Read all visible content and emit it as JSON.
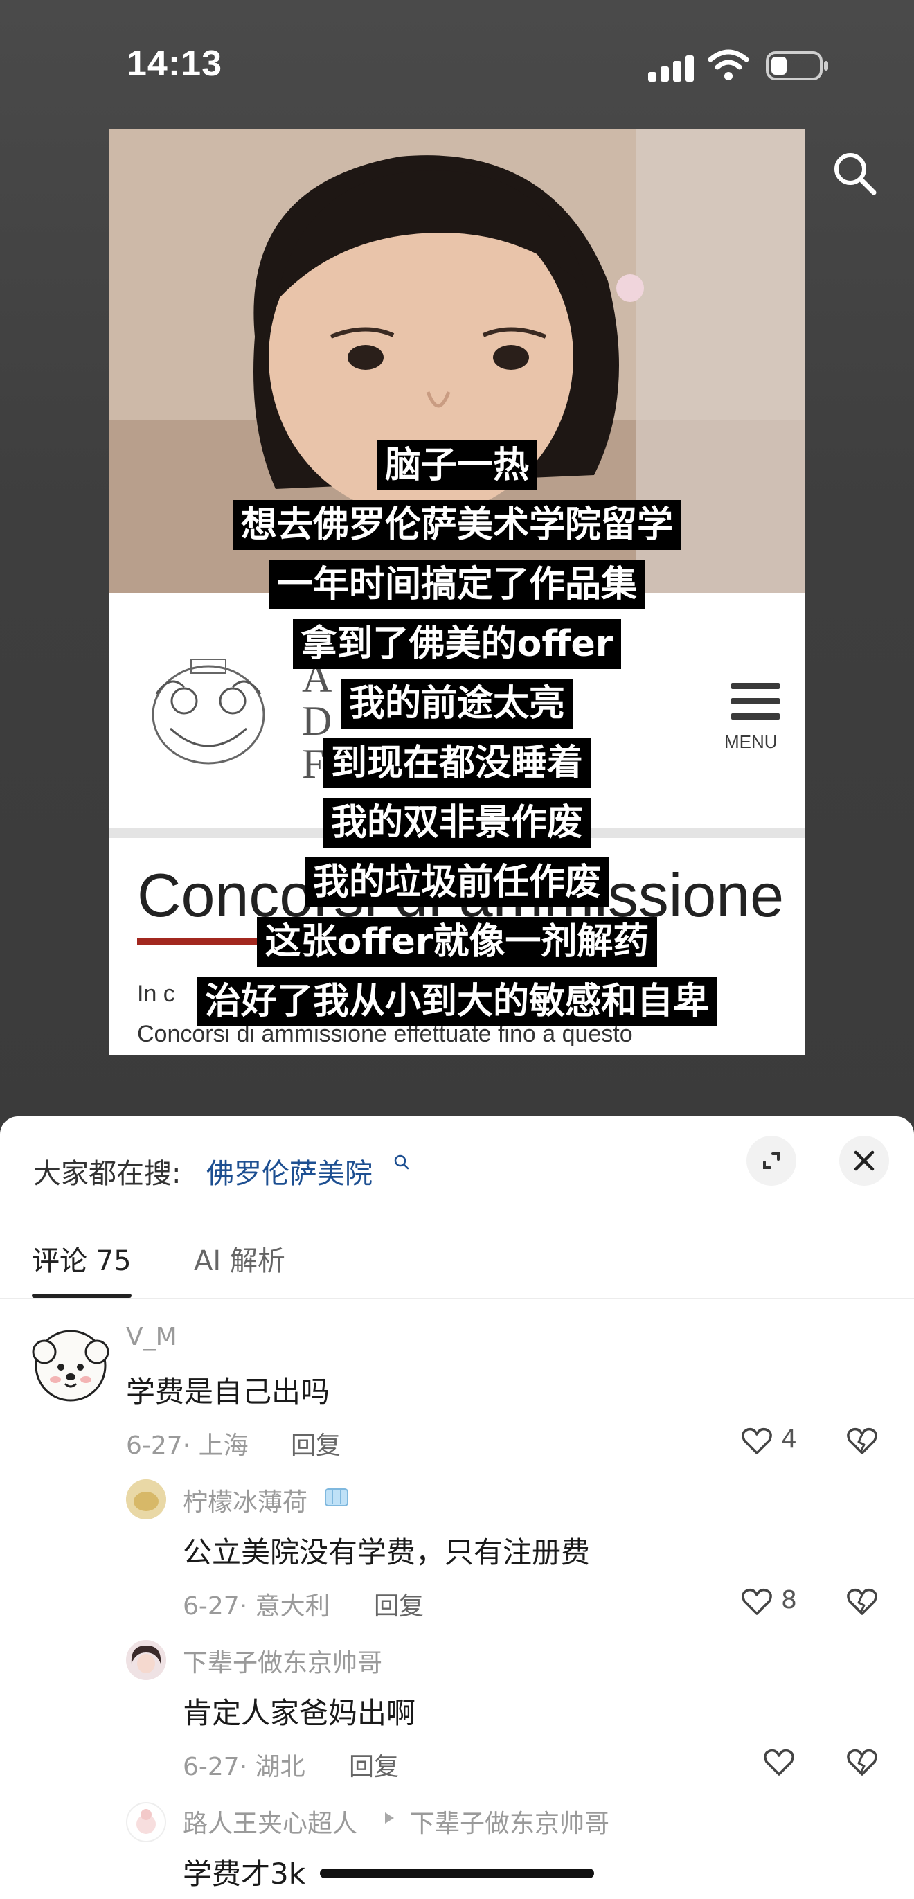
{
  "status_bar": {
    "time": "14:13"
  },
  "video": {
    "website_menu_label": "MENU",
    "website_heading": "Concorsi di ammissione",
    "website_paragraph_1": "In c",
    "website_paragraph_2": "Concorsi di ammissione effettuate fino a questo",
    "captions": [
      "脑子一热",
      "想去佛罗伦萨美术学院留学",
      "一年时间搞定了作品集",
      "拿到了佛美的offer",
      "我的前途太亮",
      "到现在都没睡着",
      "我的双非景作废",
      "我的垃圾前任作废",
      "这张offer就像一剂解药",
      "治好了我从小到大的敏感和自卑"
    ]
  },
  "comments_panel": {
    "trending_label": "大家都在搜:",
    "trending_query": "佛罗伦萨美院",
    "tabs": [
      {
        "label": "评论 75",
        "active": true
      },
      {
        "label": "AI 解析",
        "active": false
      }
    ],
    "reply_label": "回复",
    "comments": [
      {
        "username": "V_M",
        "text": "学费是自己出吗",
        "meta": "6-27· 上海",
        "likes": "4"
      },
      {
        "username": "柠檬冰薄荷",
        "text": "公立美院没有学费，只有注册费",
        "meta": "6-27· 意大利",
        "likes": "8"
      },
      {
        "username": "下辈子做东京帅哥",
        "text": "肯定人家爸妈出啊",
        "meta": "6-27· 湖北",
        "likes": ""
      },
      {
        "username": "路人王夹心超人",
        "reply_to": "下辈子做东京帅哥",
        "text": "学费才3k"
      }
    ]
  },
  "colors": {
    "link": "#1d4f91",
    "caption_bg": "#000000",
    "muted_text": "#9a9a9a"
  }
}
